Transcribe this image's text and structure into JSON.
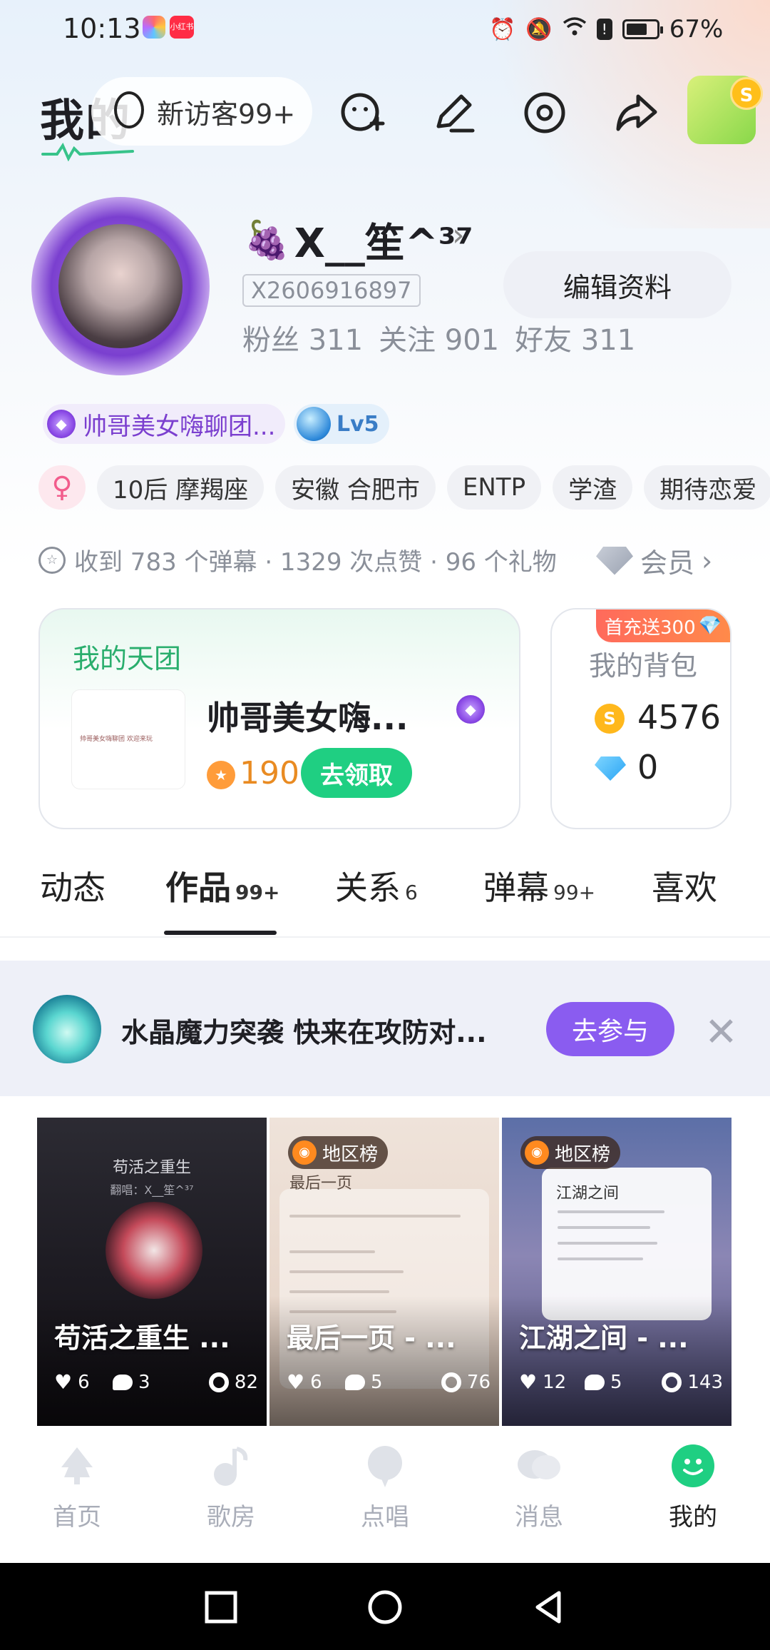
{
  "status_bar": {
    "time": "10:13",
    "app_icon_2_text": "小红书",
    "battery_pct": "67%"
  },
  "header": {
    "title": "我的",
    "visitor_pill": "新访客99+"
  },
  "profile": {
    "nickname": "X__笙^³⁷",
    "user_id": "X2606916897",
    "stats": {
      "fans": "粉丝 311",
      "following": "关注 901",
      "friends": "好友 311"
    },
    "edit_button": "编辑资料"
  },
  "badges": {
    "group_name": "帅哥美女嗨聊团...",
    "level": "Lv5"
  },
  "tags": [
    "10后 摩羯座",
    "安徽 合肥市",
    "ENTP",
    "学渣",
    "期待恋爱"
  ],
  "engagement": {
    "summary": "收到 783 个弹幕 · 1329 次点赞 · 96 个礼物",
    "vip": "会员"
  },
  "team_card": {
    "label": "我的天团",
    "thumb_text": "帅哥美女嗨聊团 欢迎来玩",
    "name": "帅哥美女嗨...",
    "points": "190",
    "claim_button": "去领取"
  },
  "bag_card": {
    "promo": "首充送300",
    "label": "我的背包",
    "coins": "4576",
    "diamonds": "0"
  },
  "tabs": [
    {
      "label": "动态",
      "count": ""
    },
    {
      "label": "作品",
      "count": "99+"
    },
    {
      "label": "关系",
      "count": "6"
    },
    {
      "label": "弹幕",
      "count": "99+"
    },
    {
      "label": "喜欢",
      "count": ""
    }
  ],
  "banner": {
    "text": "水晶魔力突袭 快来在攻防对...",
    "join_button": "去参与"
  },
  "works": [
    {
      "title": "苟活之重生 ...",
      "cover_title": "苟活之重生",
      "cover_sub": "翻唱：X__笙^³⁷",
      "rank": "",
      "likes": "6",
      "comments": "3",
      "plays": "82"
    },
    {
      "title": "最后一页 - ...",
      "cover_title": "最后一页",
      "cover_sub": "",
      "rank": "地区榜",
      "likes": "6",
      "comments": "5",
      "plays": "76"
    },
    {
      "title": "江湖之间 - ...",
      "cover_title": "江湖之间",
      "cover_sub": "",
      "rank": "地区榜",
      "likes": "12",
      "comments": "5",
      "plays": "143"
    }
  ],
  "bottom_nav": [
    {
      "label": "首页",
      "icon": "home-icon"
    },
    {
      "label": "歌房",
      "icon": "music-note-icon"
    },
    {
      "label": "点唱",
      "icon": "mic-icon"
    },
    {
      "label": "消息",
      "icon": "chat-icon"
    },
    {
      "label": "我的",
      "icon": "me-icon"
    }
  ],
  "colors": {
    "accent_green": "#1fcf82",
    "accent_purple": "#8a5cf0",
    "team_green_text": "#2aae6d",
    "coin_orange": "#e98b22"
  }
}
